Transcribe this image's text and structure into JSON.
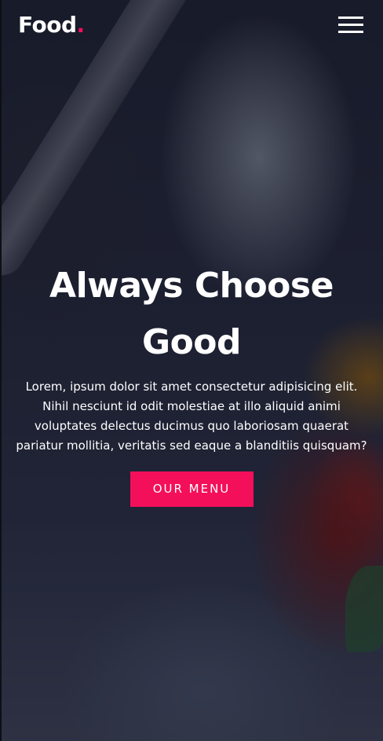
{
  "header": {
    "logo_text": "Food",
    "logo_dot": ".",
    "menu_icon": "hamburger-menu-icon"
  },
  "hero": {
    "title": "Always Choose Good",
    "description": "Lorem, ipsum dolor sit amet consectetur adipisicing elit. Nihil nesciunt id odit molestiae at illo aliquid animi voluptates delectus ducimus quo laboriosam quaerat pariatur mollitia, veritatis sed eaque a blanditiis quisquam?",
    "button_label": "OUR MENU"
  },
  "colors": {
    "accent": "#f40f5b",
    "text": "#ffffff"
  }
}
